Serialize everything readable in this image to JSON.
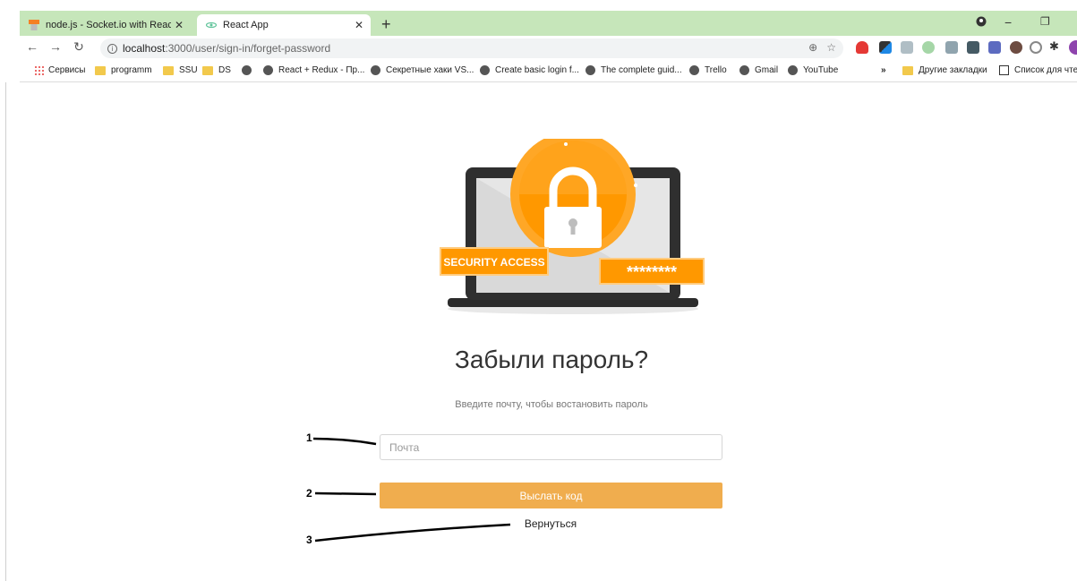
{
  "browser": {
    "tabs": [
      {
        "title": "node.js - Socket.io with React bei",
        "active": false
      },
      {
        "title": "React App",
        "active": true
      }
    ],
    "new_tab_label": "+",
    "url_host": "localhost",
    "url_path": ":3000/user/sign-in/forget-password",
    "bookmarks": [
      {
        "label": "Сервисы",
        "icon": "apps-icon"
      },
      {
        "label": "programm",
        "icon": "folder-icon"
      },
      {
        "label": "SSU",
        "icon": "folder-icon"
      },
      {
        "label": "DS",
        "icon": "folder-icon"
      },
      {
        "label": "",
        "icon": "globe-icon"
      },
      {
        "label": "React + Redux - Пр...",
        "icon": "globe-icon"
      },
      {
        "label": "Секретные хаки VS...",
        "icon": "globe-icon"
      },
      {
        "label": "Create basic login f...",
        "icon": "globe-icon"
      },
      {
        "label": "The complete guid...",
        "icon": "globe-icon"
      },
      {
        "label": "Trello",
        "icon": "globe-icon"
      },
      {
        "label": "Gmail",
        "icon": "globe-icon"
      },
      {
        "label": "YouTube",
        "icon": "globe-icon"
      }
    ],
    "bookmarks_overflow": "»",
    "other_bookmarks": "Другие закладки",
    "reading_list": "Список для чтен"
  },
  "page": {
    "illustration": {
      "badge_text": "SECURITY ACCESS",
      "password_mask": "********"
    },
    "title": "Забыли пароль?",
    "subtitle": "Введите почту, чтобы востановить пароль",
    "email_placeholder": "Почта",
    "send_button_label": "Выслать код",
    "back_link_label": "Вернуться"
  },
  "annotations": [
    "1",
    "2",
    "3"
  ],
  "colors": {
    "accent_button": "#f0ad4e",
    "tab_strip": "#c6e6ba",
    "illustration_orange": "#ff9800"
  }
}
